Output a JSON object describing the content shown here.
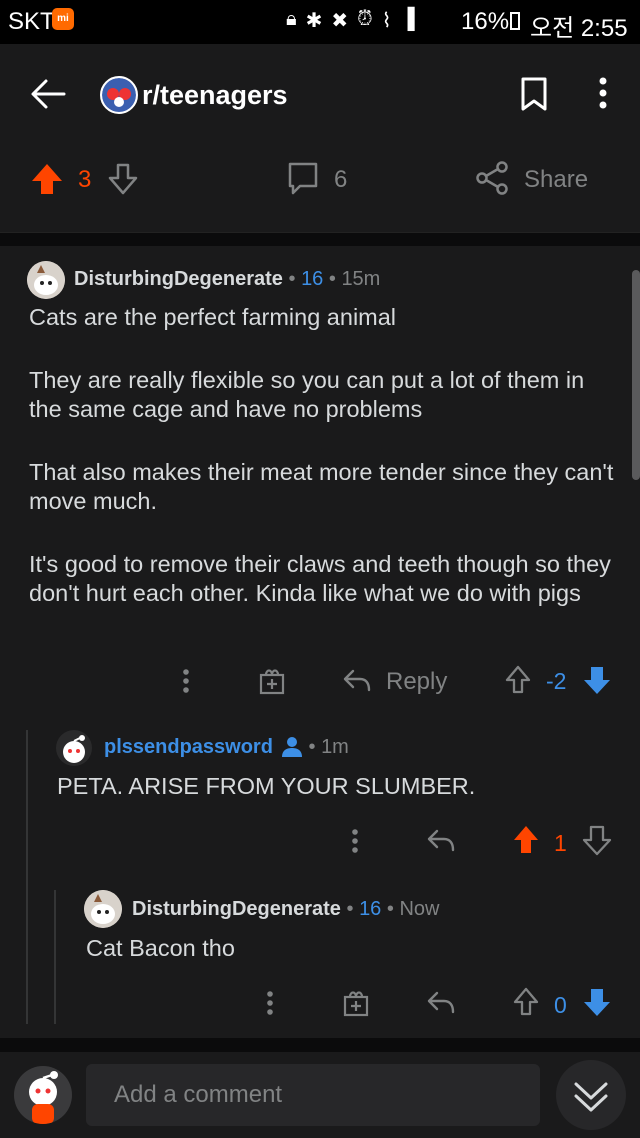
{
  "status_bar": {
    "carrier": "SKT",
    "carrier_badge": "mi",
    "battery": "16%",
    "time": "오전 2:55",
    "icons": [
      "lock-icon",
      "bluetooth-icon",
      "mute-icon",
      "alarm-icon",
      "wifi-icon",
      "signal-icon",
      "battery-icon"
    ]
  },
  "header": {
    "subreddit": "r/teenagers",
    "icons": [
      "back-arrow-icon",
      "subreddit-avatar",
      "bookmark-icon",
      "more-vertical-icon"
    ]
  },
  "post_actions": {
    "score": "3",
    "comments": "6",
    "share_label": "Share"
  },
  "comments": [
    {
      "author": "DisturbingDegenerate",
      "flair": "16",
      "time": "15m",
      "paragraphs": [
        "Cats are the perfect farming animal",
        "They are really flexible so you can put a lot of them in the same cage and have no problems",
        "That also makes their meat more tender since they can't move much.",
        "It's good to remove their claws and teeth though so they don't hurt each other. Kinda like what we do with pigs"
      ],
      "reply_label": "Reply",
      "score": "-2"
    },
    {
      "author": "plssendpassword",
      "time": "1m",
      "text": "PETA. ARISE FROM YOUR SLUMBER.",
      "score": "1"
    },
    {
      "author": "DisturbingDegenerate",
      "flair": "16",
      "time": "Now",
      "text": "Cat Bacon tho",
      "score": "0"
    }
  ],
  "comment_bar": {
    "placeholder": "Add a comment"
  },
  "colors": {
    "upvote": "#ff4500",
    "downvote": "#3d8fe6",
    "background": "#1a1a1b",
    "link_blue": "#3d8fe6"
  }
}
